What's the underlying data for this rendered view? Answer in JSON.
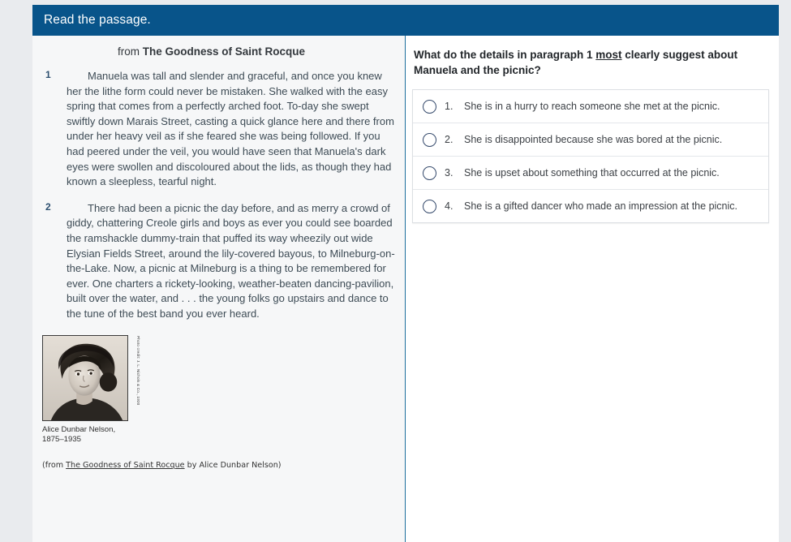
{
  "header": {
    "title": "Read the passage."
  },
  "passage": {
    "title_prefix": "from ",
    "title_work": "The Goodness of Saint Rocque",
    "paragraphs": [
      {
        "number": "1",
        "text": "Manuela was tall and slender and graceful, and once you knew her the lithe form could never be mistaken. She walked with the easy spring that comes from a perfectly arched foot. To-day she swept swiftly down Marais Street, casting a quick glance here and there from under her heavy veil as if she feared she was being followed. If you had peered under the veil, you would have seen that Manuela's dark eyes were swollen and discoloured about the lids, as though they had known a sleepless, tearful night."
      },
      {
        "number": "2",
        "text": "There had been a picnic the day before, and as merry a crowd of giddy, chattering Creole girls and boys as ever you could see boarded the ramshackle dummy-train that puffed its way wheezily out wide Elysian Fields Street, around the lily-covered bayous, to Milneburg-on-the-Lake. Now, a picnic at Milneburg is a thing to be remembered for ever. One charters a rickety-looking, weather-beaten dancing-pavilion, built over the water, and . . . the young folks go upstairs and dance to the tune of the best band you ever heard."
      }
    ],
    "figure": {
      "photo_alt": "portrait-of-alice-dunbar-nelson",
      "photo_credit": "Photo credit: J. L. Nichols & Co., 1920",
      "caption_line1": "Alice Dunbar Nelson,",
      "caption_line2": "1875–1935"
    },
    "source": {
      "open": "(from ",
      "work": "The Goodness of Saint Rocque",
      "close": " by Alice Dunbar Nelson)"
    }
  },
  "question": {
    "text_before": "What do the details in paragraph 1 ",
    "emphasis": "most",
    "text_after": " clearly suggest about Manuela and the picnic?",
    "options": [
      {
        "number": "1.",
        "label": "She is in a hurry to reach someone she met at the picnic.",
        "selected": false
      },
      {
        "number": "2.",
        "label": "She is disappointed because she was bored at the picnic.",
        "selected": false
      },
      {
        "number": "3.",
        "label": "She is upset about something that occurred at the picnic.",
        "selected": false
      },
      {
        "number": "4.",
        "label": "She is a gifted dancer who made an impression at the picnic.",
        "selected": false
      }
    ]
  },
  "colors": {
    "header_bg": "#08548a",
    "divider": "#1b6e9c",
    "passage_bg": "#f6f7f8",
    "page_bg": "#e9ebee",
    "radio_border": "#34496b",
    "body_text": "#3d4b55"
  }
}
